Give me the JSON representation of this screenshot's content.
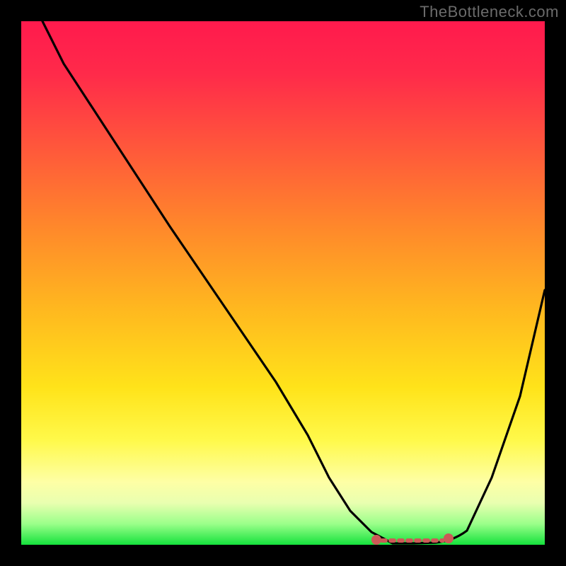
{
  "watermark": "TheBottleneck.com",
  "colors": {
    "frame": "#000000",
    "gradient_top": "#ff1a4d",
    "gradient_mid": "#ffe31a",
    "gradient_bottom": "#15e23c",
    "curve": "#000000",
    "marker": "#cc5a57"
  },
  "chart_data": {
    "type": "line",
    "title": "",
    "xlabel": "",
    "ylabel": "",
    "xlim": [
      0,
      100
    ],
    "ylim": [
      0,
      100
    ],
    "grid": false,
    "series": [
      {
        "name": "bottleneck-curve",
        "x": [
          4,
          10,
          20,
          30,
          40,
          50,
          56,
          60,
          64,
          68,
          72,
          76,
          80,
          85,
          90,
          95,
          100
        ],
        "values": [
          100,
          90,
          75,
          60,
          45,
          30,
          20,
          12,
          6,
          2,
          0,
          0,
          0,
          2,
          12,
          28,
          48
        ]
      }
    ],
    "annotations": [
      {
        "name": "flat-segment-marker",
        "type": "segment",
        "x": [
          70,
          83
        ],
        "y": [
          0.5,
          0.5
        ],
        "style": "dotted",
        "color": "#cc5a57"
      }
    ]
  }
}
